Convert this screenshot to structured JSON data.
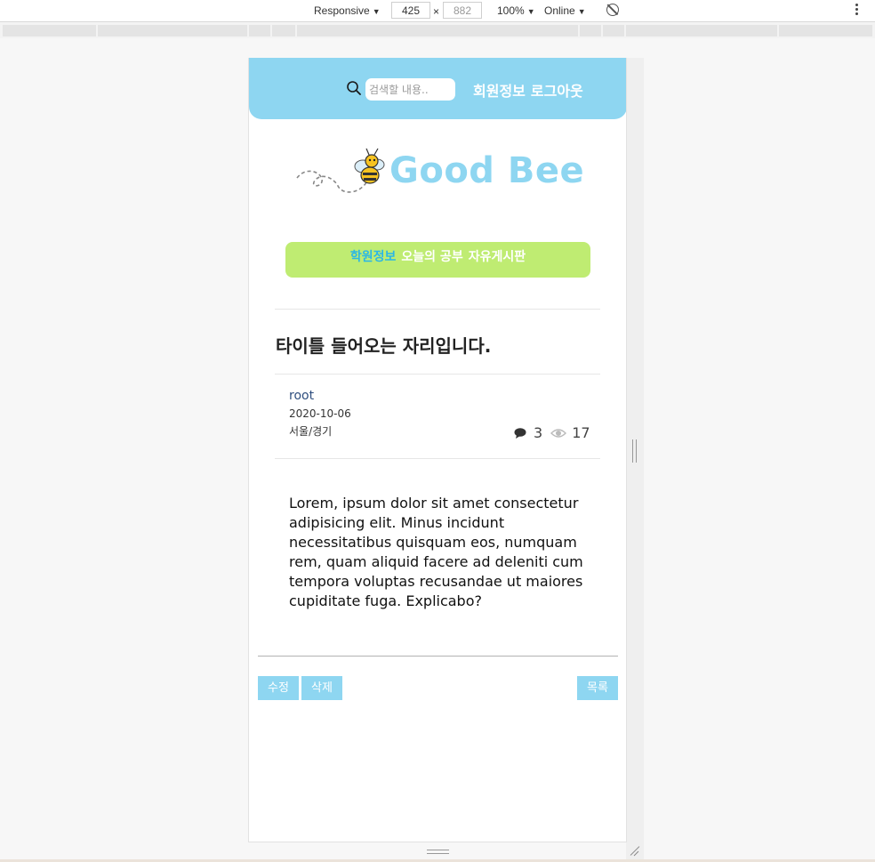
{
  "devtools": {
    "device_mode": "Responsive",
    "width": "425",
    "height": "882",
    "zoom": "100%",
    "network": "Online"
  },
  "header": {
    "search_placeholder": "검색할 내용..",
    "links": [
      "회원정보",
      "로그아웃"
    ]
  },
  "logo": {
    "text": "Good Bee"
  },
  "nav": {
    "items": [
      {
        "label": "학원정보",
        "active": true
      },
      {
        "label": "오늘의 공부",
        "active": false
      },
      {
        "label": "자유게시판",
        "active": false
      }
    ]
  },
  "post": {
    "title": "타이틀 들어오는 자리입니다.",
    "author": "root",
    "date": "2020-10-06",
    "region": "서울/경기",
    "comment_count": "3",
    "view_count": "17",
    "body": "Lorem, ipsum dolor sit amet consectetur adipisicing elit. Minus incidunt necessitatibus quisquam eos, numquam rem, quam aliquid facere ad deleniti cum tempora voluptas recusandae ut maiores cupiditate fuga. Explicabo?"
  },
  "actions": {
    "edit": "수정",
    "delete": "삭제",
    "list": "목록"
  },
  "colors": {
    "header": "#8ed6f1",
    "nav": "#bfec72",
    "nav_active_text": "#2bb7e6",
    "button": "#8ed6f1"
  }
}
